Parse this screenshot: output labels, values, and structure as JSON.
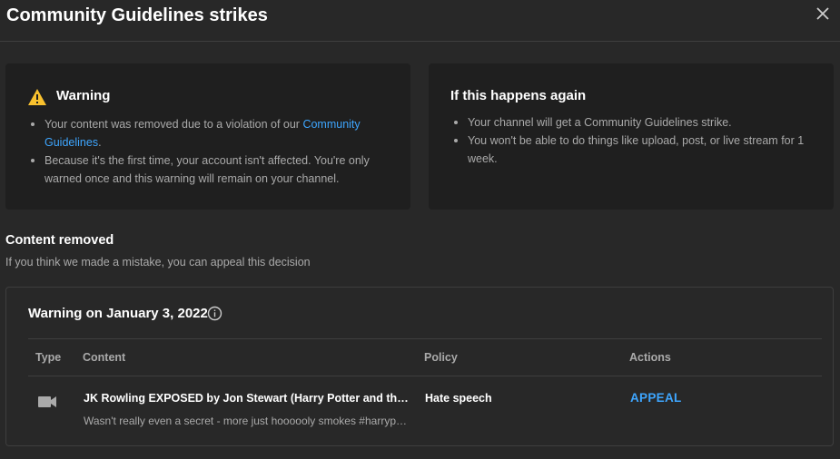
{
  "dialog": {
    "title": "Community Guidelines strikes"
  },
  "warning_card": {
    "title": "Warning",
    "icon": "warning-triangle-icon",
    "bullet1_prefix": "Your content was removed due to a violation of our ",
    "bullet1_link": "Community Guidelines",
    "bullet1_suffix": ".",
    "bullet2": "Because it's the first time, your account isn't affected. You're only warned once and this warning will remain on your channel."
  },
  "again_card": {
    "title": "If this happens again",
    "bullet1": "Your channel will get a Community Guidelines strike.",
    "bullet2": "You won't be able to do things like upload, post, or live stream for 1 week."
  },
  "content_removed": {
    "title": "Content removed",
    "subtitle": "If you think we made a mistake, you can appeal this decision"
  },
  "strike": {
    "title": "Warning on January 3, 2022",
    "columns": {
      "type": "Type",
      "content": "Content",
      "policy": "Policy",
      "actions": "Actions"
    },
    "row": {
      "type_icon": "video-camera-icon",
      "content_title": "JK Rowling EXPOSED by Jon Stewart (Harry Potter and the Goblins)",
      "content_desc": "Wasn't really even a secret - more just hoooooly smokes #harrypotter",
      "policy": "Hate speech",
      "action": "APPEAL"
    }
  },
  "colors": {
    "background": "#282828",
    "card": "#1f1f1f",
    "link": "#3ea6ff",
    "warning": "#f9c12e"
  }
}
